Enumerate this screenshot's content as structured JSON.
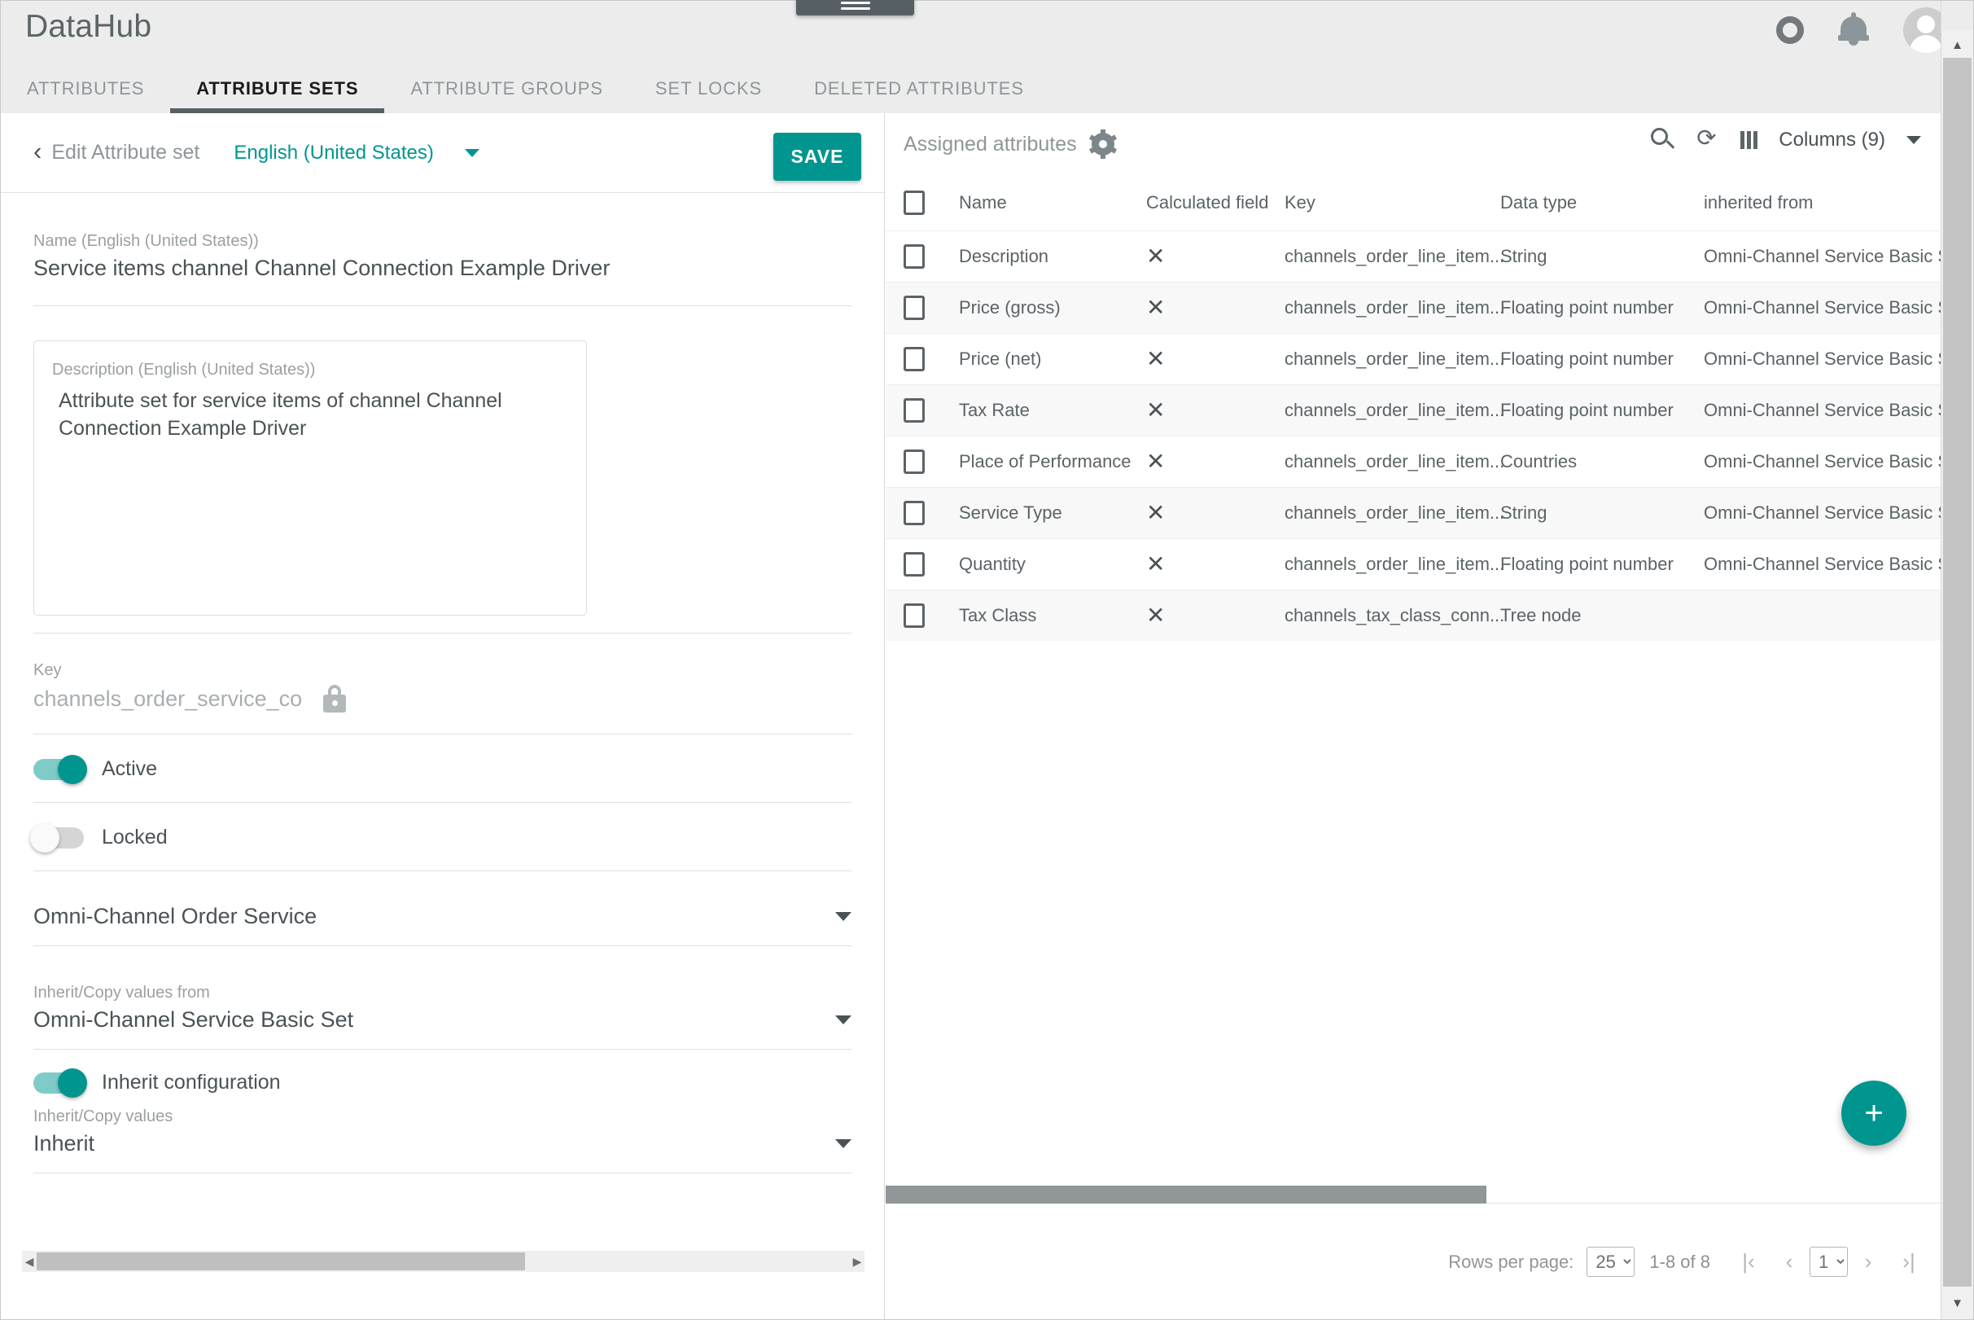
{
  "app": {
    "brand": "DataHub",
    "drag_handle_icon": "hamburger-menu-icon",
    "icons": {
      "sync": "circle-icon",
      "notifications": "bell-icon",
      "account": "avatar-icon"
    }
  },
  "tabs": [
    {
      "label": "ATTRIBUTES",
      "active": false
    },
    {
      "label": "ATTRIBUTE SETS",
      "active": true
    },
    {
      "label": "ATTRIBUTE GROUPS",
      "active": false
    },
    {
      "label": "SET LOCKS",
      "active": false
    },
    {
      "label": "DELETED ATTRIBUTES",
      "active": false
    }
  ],
  "editor": {
    "back_chevron": "‹",
    "title": "Edit Attribute set",
    "language": "English (United States)",
    "save_label": "SAVE",
    "name_label": "Name (English (United States))",
    "name_value": "Service items channel Channel Connection Example Driver",
    "description_label": "Description (English (United States))",
    "description_value": "Attribute set for service items of channel Channel Connection Example Driver",
    "key_label": "Key",
    "key_value": "channels_order_service_co",
    "active_label": "Active",
    "active_on": true,
    "locked_label": "Locked",
    "locked_on": false,
    "parent_value": "Omni-Channel Order Service",
    "inherit_from_label": "Inherit/Copy values from",
    "inherit_from_value": "Omni-Channel Service Basic Set",
    "inherit_config_label": "Inherit configuration",
    "inherit_config_on": true,
    "inherit_values_label": "Inherit/Copy values",
    "inherit_values_value": "Inherit"
  },
  "assigned": {
    "title": "Assigned attributes",
    "settings_icon": "gear-icon",
    "search_icon": "search-icon",
    "refresh_icon": "refresh-icon",
    "columns_icon": "columns-icon",
    "columns_label": "Columns (9)",
    "headers": {
      "name": "Name",
      "calculated_field": "Calculated field",
      "key": "Key",
      "data_type": "Data type",
      "inherited_from": "inherited from"
    },
    "rows": [
      {
        "name": "Description",
        "calculated": "✕",
        "key": "channels_order_line_item...",
        "data_type": "String",
        "inherited_from": "Omni-Channel Service Basic Set"
      },
      {
        "name": "Price (gross)",
        "calculated": "✕",
        "key": "channels_order_line_item...",
        "data_type": "Floating point number",
        "inherited_from": "Omni-Channel Service Basic Set"
      },
      {
        "name": "Price (net)",
        "calculated": "✕",
        "key": "channels_order_line_item...",
        "data_type": "Floating point number",
        "inherited_from": "Omni-Channel Service Basic Set"
      },
      {
        "name": "Tax Rate",
        "calculated": "✕",
        "key": "channels_order_line_item...",
        "data_type": "Floating point number",
        "inherited_from": "Omni-Channel Service Basic Set"
      },
      {
        "name": "Place of Performance",
        "calculated": "✕",
        "key": "channels_order_line_item...",
        "data_type": "Countries",
        "inherited_from": "Omni-Channel Service Basic Set"
      },
      {
        "name": "Service Type",
        "calculated": "✕",
        "key": "channels_order_line_item...",
        "data_type": "String",
        "inherited_from": "Omni-Channel Service Basic Set"
      },
      {
        "name": "Quantity",
        "calculated": "✕",
        "key": "channels_order_line_item...",
        "data_type": "Floating point number",
        "inherited_from": "Omni-Channel Service Basic Set"
      },
      {
        "name": "Tax Class",
        "calculated": "✕",
        "key": "channels_tax_class_conn...",
        "data_type": "Tree node",
        "inherited_from": ""
      }
    ],
    "add_label": "+",
    "paginator": {
      "rows_per_page_label": "Rows per page:",
      "rows_per_page_value": "25",
      "range": "1-8 of 8",
      "first_label": "|‹",
      "prev_label": "‹",
      "page_value": "1",
      "next_label": "›",
      "last_label": "›|"
    }
  },
  "colors": {
    "accent": "#00968f",
    "topbar": "#ececec",
    "tab_underline": "#566064",
    "text": "#4a5256",
    "muted": "#8e9699"
  }
}
